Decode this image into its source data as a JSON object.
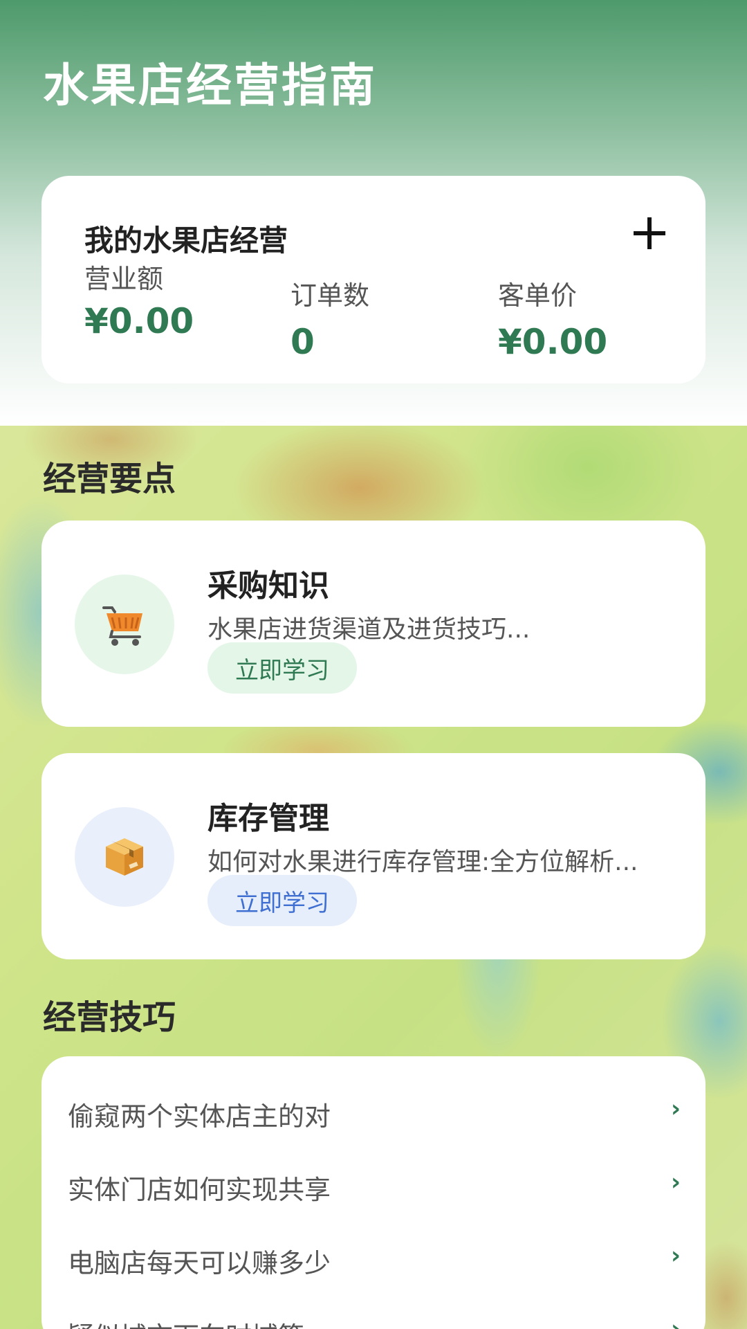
{
  "app": {
    "title": "水果店经营指南"
  },
  "stats_card": {
    "title": "我的水果店经营",
    "add_icon": "plus-icon",
    "stats": [
      {
        "label": "营业额",
        "value": "¥0.00"
      },
      {
        "label": "订单数",
        "value": "0"
      },
      {
        "label": "客单价",
        "value": "¥0.00"
      }
    ]
  },
  "sections": {
    "key_points": "经营要点",
    "tips": "经营技巧"
  },
  "features": [
    {
      "name": "采购知识",
      "description": "水果店进货渠道及进货技巧...",
      "button": "立即学习",
      "icon": "shopping-cart-icon",
      "circle_color": "#e6f7ea",
      "button_bg": "#e3f6e8",
      "button_color": "#2f7a52"
    },
    {
      "name": "库存管理",
      "description": "如何对水果进行库存管理:全方位解析...",
      "button": "立即学习",
      "icon": "package-box-icon",
      "circle_color": "#e9f0fc",
      "button_bg": "#e6eefc",
      "button_color": "#3f6fd1"
    }
  ],
  "tips": [
    {
      "label": "偷窥两个实体店主的对"
    },
    {
      "label": "实体门店如何实现共享"
    },
    {
      "label": "电脑店每天可以赚多少"
    },
    {
      "label": "疑似城市下车时域策"
    }
  ],
  "colors": {
    "accent_green": "#2f7a52",
    "header_green": "#4e9a6c"
  }
}
